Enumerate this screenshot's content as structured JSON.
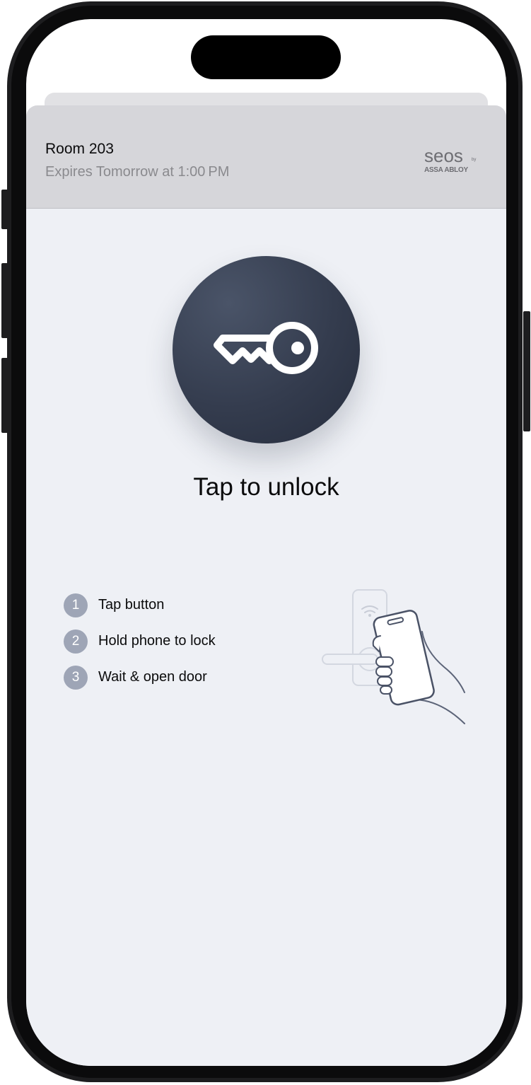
{
  "key": {
    "room": "Room 203",
    "expiry": "Expires Tomorrow at 1:00 PM"
  },
  "brand": {
    "name": "seos",
    "by": "by",
    "company": "ASSA ABLOY"
  },
  "unlock": {
    "icon": "key-icon",
    "label": "Tap to unlock"
  },
  "steps": [
    {
      "number": "1",
      "text": "Tap button"
    },
    {
      "number": "2",
      "text": "Hold phone to lock"
    },
    {
      "number": "3",
      "text": "Wait & open door"
    }
  ],
  "illustration": {
    "icon": "phone-on-lock-illustration"
  },
  "colors": {
    "button": "#343c4e",
    "sheet_background": "#eef0f5",
    "header_background": "#d6d6da",
    "step_badge": "#9ea5b6",
    "secondary_text": "#8a8a8e"
  }
}
